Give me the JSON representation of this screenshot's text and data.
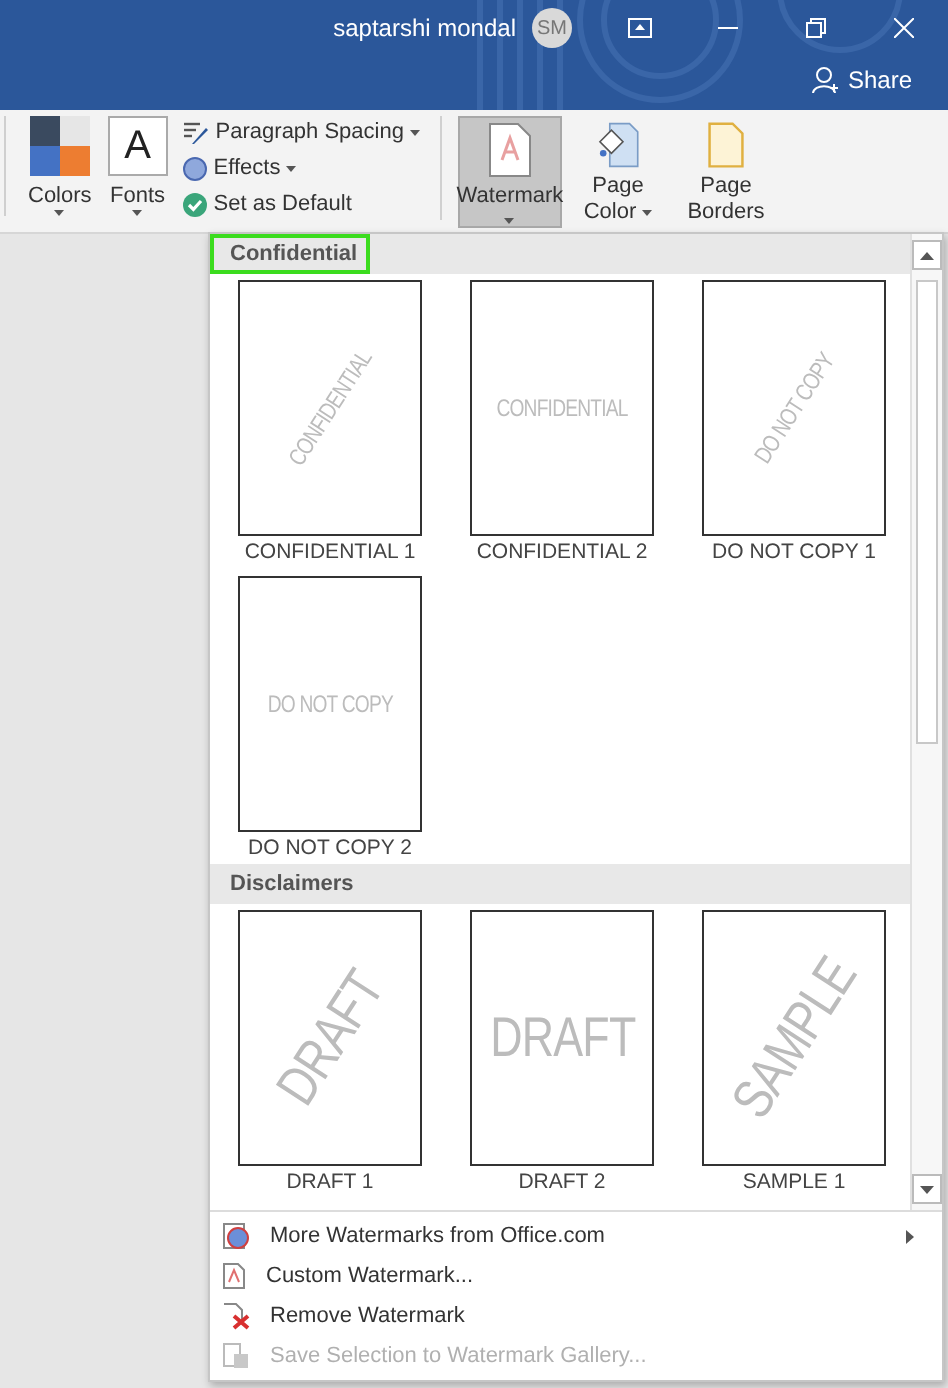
{
  "title_bar": {
    "user_name": "saptarshi mondal",
    "avatar_initials": "SM",
    "share_label": "Share"
  },
  "ribbon": {
    "large_buttons": [
      {
        "kind": "colors",
        "label": "Colors",
        "has_dropdown": true
      },
      {
        "kind": "fonts",
        "label": "Fonts",
        "icon_text": "A",
        "has_dropdown": true
      }
    ],
    "small_buttons": [
      {
        "kind": "spacing",
        "label": "Paragraph Spacing",
        "has_dropdown": true
      },
      {
        "kind": "effects",
        "label": "Effects",
        "has_dropdown": true
      },
      {
        "kind": "default",
        "label": "Set as Default",
        "has_dropdown": false
      }
    ],
    "page_buttons": [
      {
        "kind": "watermark",
        "lines": [
          "Watermark"
        ],
        "selected": true,
        "has_dropdown": true
      },
      {
        "kind": "page_color",
        "lines": [
          "Page",
          "Color"
        ],
        "selected": false,
        "has_dropdown": true
      },
      {
        "kind": "page_borders",
        "lines": [
          "Page",
          "Borders"
        ],
        "selected": false,
        "has_dropdown": false
      }
    ]
  },
  "gallery": {
    "sections": [
      {
        "title": "Confidential",
        "highlighted": true,
        "items": [
          {
            "label": "CONFIDENTIAL 1",
            "mark": "CONFIDENTIAL",
            "kind": "diagonal"
          },
          {
            "label": "CONFIDENTIAL 2",
            "mark": "CONFIDENTIAL",
            "kind": "horizontal"
          },
          {
            "label": "DO NOT COPY 1",
            "mark": "DO NOT COPY",
            "kind": "diagonal"
          },
          {
            "label": "DO NOT COPY 2",
            "mark": "DO NOT COPY",
            "kind": "horizontal"
          }
        ]
      },
      {
        "title": "Disclaimers",
        "highlighted": false,
        "items": [
          {
            "label": "DRAFT 1",
            "mark": "DRAFT",
            "kind": "bigdiagonal"
          },
          {
            "label": "DRAFT 2",
            "mark": "DRAFT",
            "kind": "bighorizontal"
          },
          {
            "label": "SAMPLE 1",
            "mark": "SAMPLE",
            "kind": "bigdiagonal"
          }
        ]
      }
    ]
  },
  "menu": [
    {
      "kind": "online",
      "label": "More Watermarks from Office.com",
      "disabled": false,
      "has_submenu": true
    },
    {
      "kind": "custom",
      "label": "Custom Watermark...",
      "disabled": false,
      "has_submenu": false
    },
    {
      "kind": "remove",
      "label": "Remove Watermark",
      "disabled": false,
      "has_submenu": false
    },
    {
      "kind": "save",
      "label": "Save Selection to Watermark Gallery...",
      "disabled": true,
      "has_submenu": false
    }
  ]
}
